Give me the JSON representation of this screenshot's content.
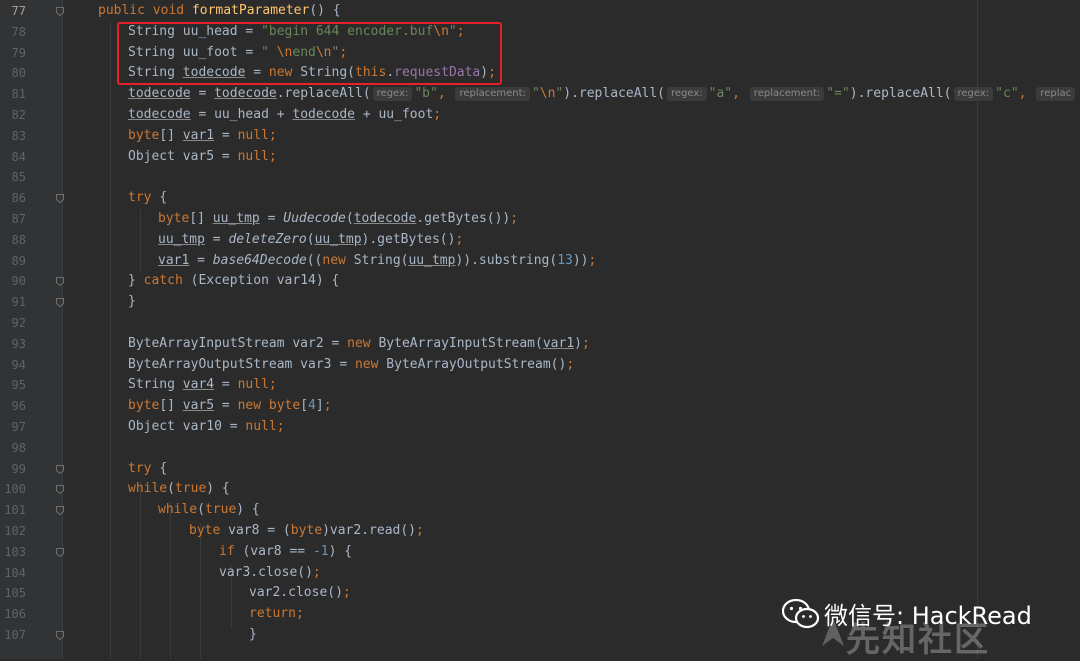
{
  "editor": {
    "colors": {
      "background": "#2b2b2b",
      "keyword": "#cc7832",
      "string": "#6a8759",
      "number": "#6897bb",
      "method": "#ffc66d",
      "field": "#9876aa",
      "highlight_box": "#e8202a"
    },
    "lines": [
      {
        "n": "77",
        "fold": true,
        "tokens": [
          [
            "kw",
            "public void "
          ],
          [
            "fn",
            "formatParameter"
          ],
          [
            "",
            "() {"
          ]
        ]
      },
      {
        "n": "78",
        "tokens": [
          [
            "",
            "String uu_head = "
          ],
          [
            "str",
            "\"begin 644 encoder.buf"
          ],
          [
            "esc",
            "\\n"
          ],
          [
            "str",
            "\""
          ],
          [
            "kw",
            ";"
          ]
        ]
      },
      {
        "n": "79",
        "tokens": [
          [
            "",
            "String uu_foot = "
          ],
          [
            "str",
            "\" "
          ],
          [
            "esc",
            "\\n"
          ],
          [
            "str",
            "end"
          ],
          [
            "esc",
            "\\n"
          ],
          [
            "str",
            "\""
          ],
          [
            "kw",
            ";"
          ]
        ]
      },
      {
        "n": "80",
        "tokens": [
          [
            "",
            "String "
          ],
          [
            "ul",
            "todecode"
          ],
          [
            "",
            " = "
          ],
          [
            "kw",
            "new "
          ],
          [
            "",
            "String("
          ],
          [
            "kw",
            "this"
          ],
          [
            "",
            "."
          ],
          [
            "fld",
            "requestData"
          ],
          [
            "",
            ")"
          ],
          [
            "kw",
            ";"
          ]
        ]
      },
      {
        "n": "81",
        "tokens": [
          [
            "ul",
            "todecode"
          ],
          [
            "",
            " = "
          ],
          [
            "ul",
            "todecode"
          ],
          [
            "",
            ".replaceAll("
          ],
          [
            "hint",
            "regex:"
          ],
          [
            "str",
            "\"b\""
          ],
          [
            "kw",
            ", "
          ],
          [
            "hint",
            "replacement:"
          ],
          [
            "str",
            "\""
          ],
          [
            "esc",
            "\\n"
          ],
          [
            "str",
            "\""
          ],
          [
            "",
            ").replaceAll("
          ],
          [
            "hint",
            "regex:"
          ],
          [
            "str",
            "\"a\""
          ],
          [
            "kw",
            ", "
          ],
          [
            "hint",
            "replacement:"
          ],
          [
            "str",
            "\"=\""
          ],
          [
            "",
            ").replaceAll("
          ],
          [
            "hint",
            "regex:"
          ],
          [
            "str",
            "\"c\""
          ],
          [
            "kw",
            ", "
          ],
          [
            "hint",
            "replac"
          ]
        ]
      },
      {
        "n": "82",
        "tokens": [
          [
            "ul",
            "todecode"
          ],
          [
            "",
            " = uu_head + "
          ],
          [
            "ul",
            "todecode"
          ],
          [
            "",
            " + uu_foot"
          ],
          [
            "kw",
            ";"
          ]
        ]
      },
      {
        "n": "83",
        "tokens": [
          [
            "kw",
            "byte"
          ],
          [
            "",
            "[] "
          ],
          [
            "ul",
            "var1"
          ],
          [
            "",
            " = "
          ],
          [
            "kw",
            "null;"
          ]
        ]
      },
      {
        "n": "84",
        "tokens": [
          [
            "",
            "Object var5 = "
          ],
          [
            "kw",
            "null;"
          ]
        ]
      },
      {
        "n": "85",
        "tokens": []
      },
      {
        "n": "86",
        "fold": true,
        "tokens": [
          [
            "kw",
            "try "
          ],
          [
            "",
            "{"
          ]
        ]
      },
      {
        "n": "87",
        "tokens": [
          [
            "kw",
            "byte"
          ],
          [
            "",
            "[] "
          ],
          [
            "ul",
            "uu_tmp"
          ],
          [
            "",
            " = "
          ],
          [
            "it",
            "Uudecode"
          ],
          [
            "",
            "("
          ],
          [
            "ul",
            "todecode"
          ],
          [
            "",
            ".getBytes())"
          ],
          [
            "kw",
            ";"
          ]
        ]
      },
      {
        "n": "88",
        "tokens": [
          [
            "ul",
            "uu_tmp"
          ],
          [
            "",
            " = "
          ],
          [
            "it",
            "deleteZero"
          ],
          [
            "",
            "("
          ],
          [
            "ul",
            "uu_tmp"
          ],
          [
            "",
            ").getBytes()"
          ],
          [
            "kw",
            ";"
          ]
        ]
      },
      {
        "n": "89",
        "tokens": [
          [
            "ul",
            "var1"
          ],
          [
            "",
            " = "
          ],
          [
            "it",
            "base64Decode"
          ],
          [
            "",
            "(("
          ],
          [
            "kw",
            "new "
          ],
          [
            "",
            "String("
          ],
          [
            "ul",
            "uu_tmp"
          ],
          [
            "",
            ")).substring("
          ],
          [
            "num",
            "13"
          ],
          [
            "",
            "))"
          ],
          [
            "kw",
            ";"
          ]
        ]
      },
      {
        "n": "90",
        "fold": true,
        "tokens": [
          [
            "",
            "} "
          ],
          [
            "kw",
            "catch "
          ],
          [
            "",
            "(Exception var14) {"
          ]
        ]
      },
      {
        "n": "91",
        "fold": true,
        "tokens": [
          [
            "",
            "}"
          ]
        ]
      },
      {
        "n": "92",
        "tokens": []
      },
      {
        "n": "93",
        "tokens": [
          [
            "",
            "ByteArrayInputStream var2 = "
          ],
          [
            "kw",
            "new "
          ],
          [
            "",
            "ByteArrayInputStream("
          ],
          [
            "ul",
            "var1"
          ],
          [
            "",
            ")"
          ],
          [
            "kw",
            ";"
          ]
        ]
      },
      {
        "n": "94",
        "tokens": [
          [
            "",
            "ByteArrayOutputStream var3 = "
          ],
          [
            "kw",
            "new "
          ],
          [
            "",
            "ByteArrayOutputStream()"
          ],
          [
            "kw",
            ";"
          ]
        ]
      },
      {
        "n": "95",
        "tokens": [
          [
            "",
            "String "
          ],
          [
            "ul",
            "var4"
          ],
          [
            "",
            " = "
          ],
          [
            "kw",
            "null;"
          ]
        ]
      },
      {
        "n": "96",
        "tokens": [
          [
            "kw",
            "byte"
          ],
          [
            "",
            "[] "
          ],
          [
            "ul",
            "var5"
          ],
          [
            "",
            " = "
          ],
          [
            "kw",
            "new byte"
          ],
          [
            "",
            "["
          ],
          [
            "num",
            "4"
          ],
          [
            "",
            "]"
          ],
          [
            "kw",
            ";"
          ]
        ]
      },
      {
        "n": "97",
        "tokens": [
          [
            "",
            "Object var10 = "
          ],
          [
            "kw",
            "null;"
          ]
        ]
      },
      {
        "n": "98",
        "tokens": []
      },
      {
        "n": "99",
        "fold": true,
        "tokens": [
          [
            "kw",
            "try "
          ],
          [
            "",
            "{"
          ]
        ]
      },
      {
        "n": "100",
        "fold": true,
        "tokens": [
          [
            "kw",
            "while"
          ],
          [
            "",
            "("
          ],
          [
            "kw",
            "true"
          ],
          [
            "",
            ") {"
          ]
        ]
      },
      {
        "n": "101",
        "fold": true,
        "tokens": [
          [
            "kw",
            "while"
          ],
          [
            "",
            "("
          ],
          [
            "kw",
            "true"
          ],
          [
            "",
            ") {"
          ]
        ]
      },
      {
        "n": "102",
        "tokens": [
          [
            "kw",
            "byte "
          ],
          [
            "",
            "var8 = ("
          ],
          [
            "kw",
            "byte"
          ],
          [
            "",
            ")var2.read()"
          ],
          [
            "kw",
            ";"
          ]
        ]
      },
      {
        "n": "103",
        "fold": true,
        "tokens": [
          [
            "kw",
            "if "
          ],
          [
            "",
            "(var8 == "
          ],
          [
            "num",
            "-1"
          ],
          [
            "",
            ") {"
          ]
        ]
      },
      {
        "n": "104",
        "tokens": [
          [
            "",
            "var3.close()"
          ],
          [
            "kw",
            ";"
          ]
        ]
      },
      {
        "n": "105",
        "tokens": [
          [
            "",
            "var2.close()"
          ],
          [
            "kw",
            ";"
          ]
        ]
      },
      {
        "n": "106",
        "tokens": [
          [
            "kw",
            "return;"
          ]
        ]
      },
      {
        "n": "107",
        "fold": true,
        "tokens": [
          [
            "",
            "}"
          ]
        ]
      }
    ]
  },
  "watermark": {
    "label": "微信号: HackRead",
    "brand": "先知社区",
    "icon": "wechat-icon"
  }
}
